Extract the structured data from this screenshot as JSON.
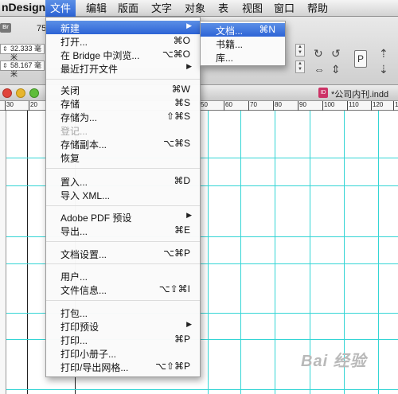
{
  "app_name": "nDesign",
  "menubar": [
    {
      "label": "文件",
      "active": true
    },
    {
      "label": "编辑"
    },
    {
      "label": "版面"
    },
    {
      "label": "文字"
    },
    {
      "label": "对象"
    },
    {
      "label": "表"
    },
    {
      "label": "视图"
    },
    {
      "label": "窗口"
    },
    {
      "label": "帮助"
    }
  ],
  "control_panel": {
    "bridge_badge": "Br",
    "zoom_partial": "75",
    "x_value": "32.333 毫米",
    "y_value": "58.167 毫米",
    "frame_glyph": "P",
    "cut_label": "米"
  },
  "document": {
    "title": "*公司内刊.indd"
  },
  "ruler": {
    "ticks": [
      "30",
      "20",
      "50",
      "60",
      "70",
      "80",
      "90",
      "100",
      "110",
      "120",
      "130"
    ]
  },
  "file_menu": {
    "items": [
      {
        "label": "新建",
        "shortcut": "",
        "submenu": true,
        "highlighted": true
      },
      {
        "label": "打开...",
        "shortcut": "⌘O"
      },
      {
        "label": "在 Bridge 中浏览...",
        "shortcut": "⌥⌘O"
      },
      {
        "label": "最近打开文件",
        "shortcut": "",
        "submenu": true
      },
      {
        "label": "关闭",
        "shortcut": "⌘W"
      },
      {
        "label": "存储",
        "shortcut": "⌘S"
      },
      {
        "label": "存储为...",
        "shortcut": "⇧⌘S"
      },
      {
        "label": "登记...",
        "shortcut": "",
        "disabled": true
      },
      {
        "label": "存储副本...",
        "shortcut": "⌥⌘S"
      },
      {
        "label": "恢复",
        "shortcut": ""
      },
      {
        "label": "置入...",
        "shortcut": "⌘D"
      },
      {
        "label": "导入 XML...",
        "shortcut": ""
      },
      {
        "label": "Adobe PDF 预设",
        "shortcut": "",
        "submenu": true
      },
      {
        "label": "导出...",
        "shortcut": "⌘E"
      },
      {
        "label": "文档设置...",
        "shortcut": "⌥⌘P"
      },
      {
        "label": "用户...",
        "shortcut": ""
      },
      {
        "label": "文件信息...",
        "shortcut": "⌥⇧⌘I"
      },
      {
        "label": "打包...",
        "shortcut": ""
      },
      {
        "label": "打印预设",
        "shortcut": "",
        "submenu": true
      },
      {
        "label": "打印...",
        "shortcut": "⌘P"
      },
      {
        "label": "打印小册子...",
        "shortcut": ""
      },
      {
        "label": "打印/导出网格...",
        "shortcut": "⌥⇧⌘P"
      }
    ]
  },
  "new_submenu": {
    "items": [
      {
        "label": "文档...",
        "shortcut": "⌘N",
        "highlighted": true
      },
      {
        "label": "书籍...",
        "shortcut": ""
      },
      {
        "label": "库...",
        "shortcut": ""
      }
    ]
  },
  "watermark": "Bai 经验",
  "colors": {
    "highlight": "#2d64d6",
    "guide": "#34d5d5"
  }
}
